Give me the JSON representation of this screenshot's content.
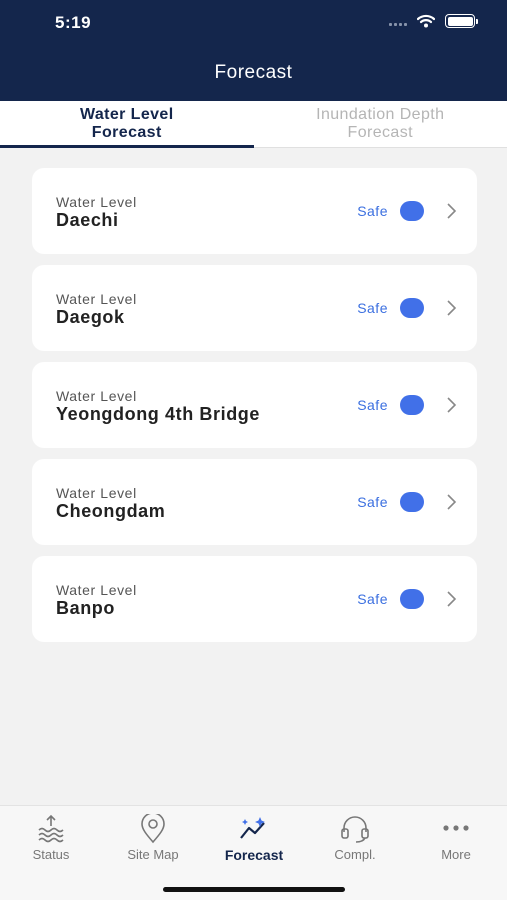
{
  "status_bar": {
    "time": "5:19"
  },
  "header": {
    "title": "Forecast"
  },
  "tabs": [
    {
      "label_line1": "Water Level",
      "label_line2": "Forecast",
      "active": true
    },
    {
      "label_line1": "Inundation Depth",
      "label_line2": "Forecast",
      "active": false
    }
  ],
  "stations": [
    {
      "category": "Water Level",
      "name": "Daechi",
      "status": "Safe"
    },
    {
      "category": "Water Level",
      "name": "Daegok",
      "status": "Safe"
    },
    {
      "category": "Water Level",
      "name": "Yeongdong 4th Bridge",
      "status": "Safe"
    },
    {
      "category": "Water Level",
      "name": "Cheongdam",
      "status": "Safe"
    },
    {
      "category": "Water Level",
      "name": "Banpo",
      "status": "Safe"
    }
  ],
  "bottom_nav": [
    {
      "label": "Status",
      "icon": "water-waves-icon"
    },
    {
      "label": "Site Map",
      "icon": "map-pin-icon"
    },
    {
      "label": "Forecast",
      "icon": "forecast-chart-icon",
      "active": true
    },
    {
      "label": "Compl.",
      "icon": "headset-icon"
    },
    {
      "label": "More",
      "icon": "more-dots-icon"
    }
  ],
  "colors": {
    "header_bg": "#14264c",
    "accent": "#4170e8",
    "status_safe": "#3b6fe0"
  }
}
